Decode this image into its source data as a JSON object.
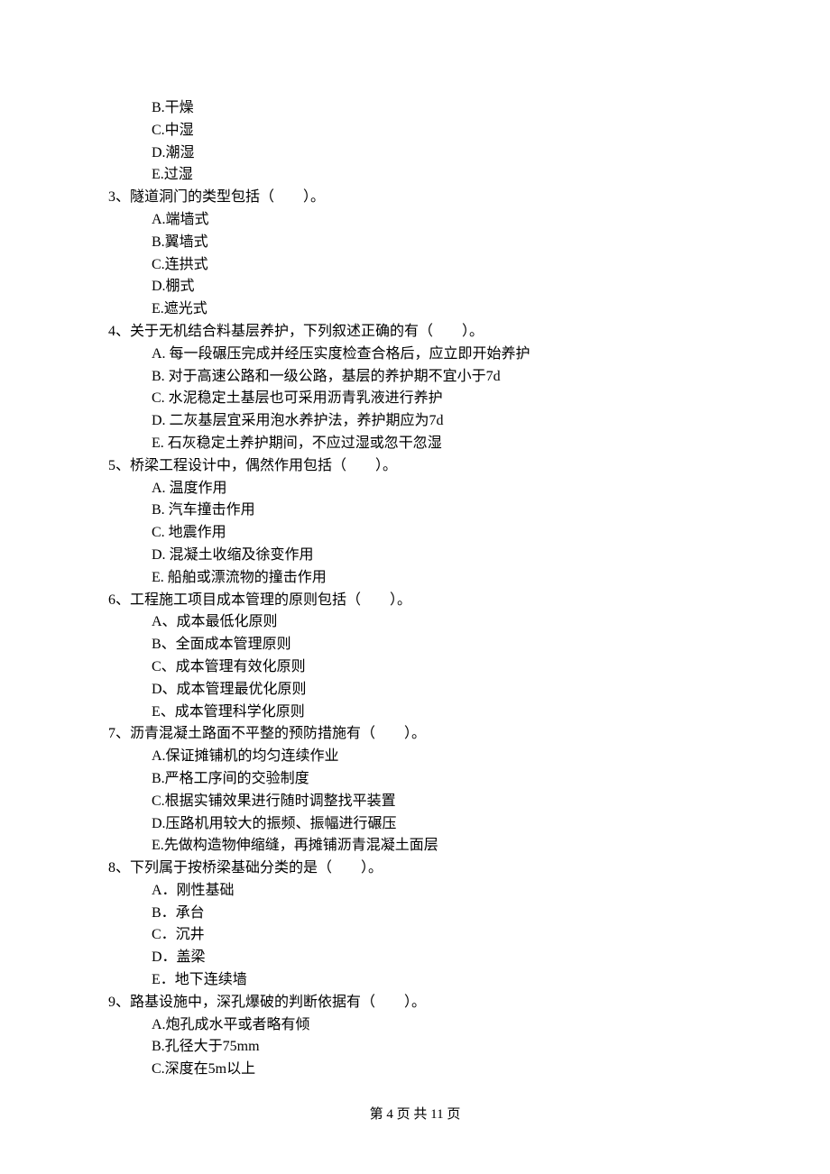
{
  "orphan_options": [
    "B.干燥",
    "C.中湿",
    "D.潮湿",
    "E.过湿"
  ],
  "questions": [
    {
      "stem": "3、隧道洞门的类型包括（　　）。",
      "options": [
        "A.端墙式",
        "B.翼墙式",
        "C.连拱式",
        "D.棚式",
        "E.遮光式"
      ]
    },
    {
      "stem": "4、关于无机结合料基层养护，下列叙述正确的有（　　）。",
      "options": [
        "A. 每一段碾压完成并经压实度检查合格后，应立即开始养护",
        "B. 对于高速公路和一级公路，基层的养护期不宜小于7d",
        "C. 水泥稳定土基层也可采用沥青乳液进行养护",
        "D. 二灰基层宜采用泡水养护法，养护期应为7d",
        "E. 石灰稳定土养护期间，不应过湿或忽干忽湿"
      ]
    },
    {
      "stem": "5、桥梁工程设计中，偶然作用包括（　　）。",
      "options": [
        "A. 温度作用",
        "B. 汽车撞击作用",
        "C. 地震作用",
        "D. 混凝土收缩及徐变作用",
        "E. 船舶或漂流物的撞击作用"
      ]
    },
    {
      "stem": "6、工程施工项目成本管理的原则包括（　　）。",
      "options": [
        "A、成本最低化原则",
        "B、全面成本管理原则",
        "C、成本管理有效化原则",
        "D、成本管理最优化原则",
        "E、成本管理科学化原则"
      ]
    },
    {
      "stem": "7、沥青混凝土路面不平整的预防措施有（　　）。",
      "options": [
        "A.保证摊铺机的均匀连续作业",
        "B.严格工序间的交验制度",
        "C.根据实铺效果进行随时调整找平装置",
        "D.压路机用较大的振频、振幅进行碾压",
        "E.先做构造物伸缩缝，再摊铺沥青混凝土面层"
      ]
    },
    {
      "stem": "8、下列属于按桥梁基础分类的是（　　）。",
      "options": [
        "A．刚性基础",
        "B．承台",
        "C．沉井",
        "D．盖梁",
        "E．地下连续墙"
      ]
    },
    {
      "stem": "9、路基设施中，深孔爆破的判断依据有（　　）。",
      "options": [
        "A.炮孔成水平或者略有倾",
        "B.孔径大于75mm",
        "C.深度在5m以上"
      ]
    }
  ],
  "footer": "第 4 页 共 11 页"
}
